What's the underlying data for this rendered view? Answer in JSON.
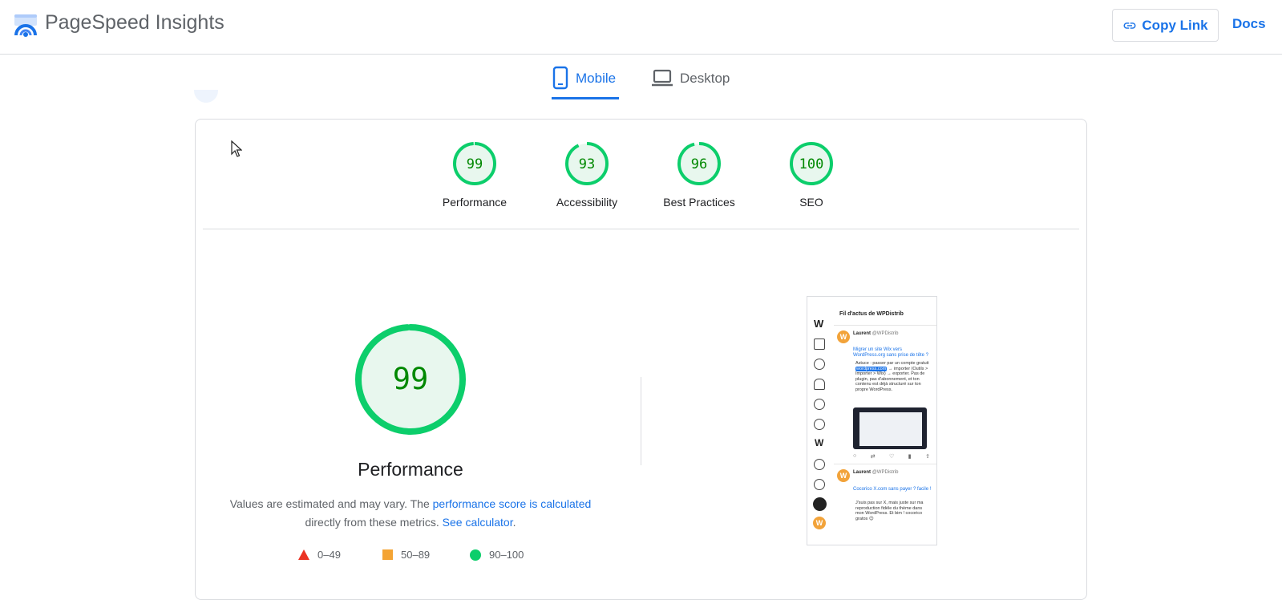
{
  "header": {
    "brand": "PageSpeed Insights",
    "copy_link": "Copy Link",
    "docs": "Docs",
    "accent": "#1a73e8"
  },
  "tabs": [
    {
      "label": "Mobile",
      "active": true,
      "icon": "smartphone-icon"
    },
    {
      "label": "Desktop",
      "active": false,
      "icon": "laptop-icon"
    }
  ],
  "scores": [
    {
      "label": "Performance",
      "value": 99
    },
    {
      "label": "Accessibility",
      "value": 93
    },
    {
      "label": "Best Practices",
      "value": 96
    },
    {
      "label": "SEO",
      "value": 100
    }
  ],
  "performance": {
    "score": 99,
    "title": "Performance",
    "note_prefix": "Values are estimated and may vary. The ",
    "note_link": "performance score is calculated",
    "note_middle": " directly from these metrics. ",
    "note_calc": "See calculator",
    "note_suffix": "."
  },
  "legend": [
    {
      "range": "0–49",
      "shape": "triangle",
      "color": "#eb3323"
    },
    {
      "range": "50–89",
      "shape": "square",
      "color": "#f4a434"
    },
    {
      "range": "90–100",
      "shape": "circle",
      "color": "#0cce6b"
    }
  ],
  "colors": {
    "good": "#0cce6b",
    "good_fill": "#e8f7ee",
    "good_text": "#008800"
  },
  "thumbnail": {
    "heading": "Fil d'actus de WPDistrib",
    "post1_name": "Laurent",
    "post1_handle": "@WPDistrib",
    "post1_link": "Migrer un site Wix vers WordPress.org sans prise de tête ?",
    "post1_text_a": "Astuce : passer par un compte gratuit ",
    "post1_highlight": "wordpress.com",
    "post1_text_b": " → importer (Outils > Importer > Wix) → exporter. Pas de plugin, pas d'abonnement, et ton contenu est déjà structuré sur ton propre WordPress.",
    "post2_name": "Laurent",
    "post2_handle": "@WPDistrib",
    "post2_link": "Cocorico X.com sans payer ? facile !",
    "post2_text": "J'suis pas sur X, mais juste sur ma reproduction fidèle du thème dans mon WordPress. Et bim ! cocorico gratos 😉"
  }
}
